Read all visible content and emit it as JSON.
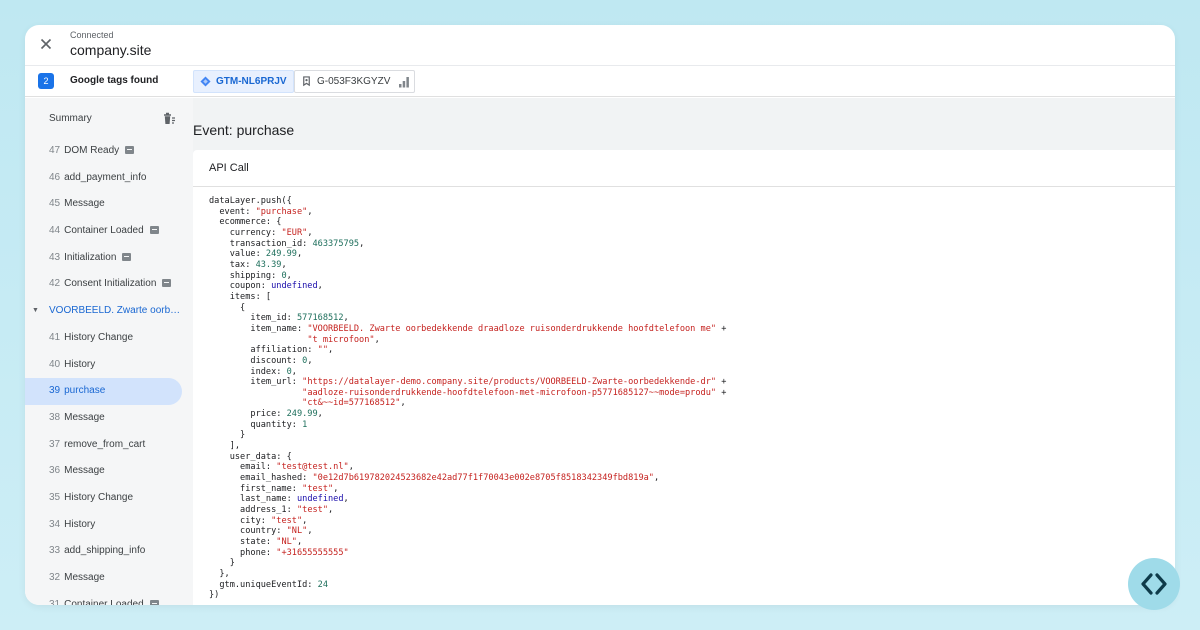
{
  "header": {
    "status": "Connected",
    "site": "company.site"
  },
  "tagsbar": {
    "count": "2",
    "label": "Google tags found",
    "tags": [
      {
        "id": "GTM-NL6PRJV",
        "icon": "gtm-diamond-icon",
        "active": true
      },
      {
        "id": "G-053F3KGYZV",
        "icon": "ga-tag-icon",
        "active": false
      }
    ]
  },
  "sidebar": {
    "summary": "Summary",
    "events": [
      {
        "num": "47",
        "label": "DOM Ready",
        "cmd": true
      },
      {
        "num": "46",
        "label": "add_payment_info",
        "cmd": false
      },
      {
        "num": "45",
        "label": "Message",
        "cmd": false
      },
      {
        "num": "44",
        "label": "Container Loaded",
        "cmd": true
      },
      {
        "num": "43",
        "label": "Initialization",
        "cmd": true
      },
      {
        "num": "42",
        "label": "Consent Initialization",
        "cmd": true
      },
      {
        "num": "",
        "label": "VOORBEELD. Zwarte oorb…",
        "cmd": false,
        "page": true
      },
      {
        "num": "41",
        "label": "History Change",
        "cmd": false
      },
      {
        "num": "40",
        "label": "History",
        "cmd": false
      },
      {
        "num": "39",
        "label": "purchase",
        "cmd": false,
        "selected": true
      },
      {
        "num": "38",
        "label": "Message",
        "cmd": false
      },
      {
        "num": "37",
        "label": "remove_from_cart",
        "cmd": false
      },
      {
        "num": "36",
        "label": "Message",
        "cmd": false
      },
      {
        "num": "35",
        "label": "History Change",
        "cmd": false
      },
      {
        "num": "34",
        "label": "History",
        "cmd": false
      },
      {
        "num": "33",
        "label": "add_shipping_info",
        "cmd": false
      },
      {
        "num": "32",
        "label": "Message",
        "cmd": false
      },
      {
        "num": "31",
        "label": "Container Loaded",
        "cmd": true
      }
    ]
  },
  "main": {
    "event_title": "Event: purchase",
    "card_title": "API Call",
    "code_lines": [
      [
        [
          "",
          "dataLayer.push({"
        ]
      ],
      [
        [
          "",
          "  event: "
        ],
        [
          "s",
          "\"purchase\""
        ],
        [
          "",
          ","
        ]
      ],
      [
        [
          "",
          "  ecommerce: {"
        ]
      ],
      [
        [
          "",
          "    currency: "
        ],
        [
          "s",
          "\"EUR\""
        ],
        [
          "",
          ","
        ]
      ],
      [
        [
          "",
          "    transaction_id: "
        ],
        [
          "n",
          "463375795"
        ],
        [
          "",
          ","
        ]
      ],
      [
        [
          "",
          "    value: "
        ],
        [
          "n",
          "249.99"
        ],
        [
          "",
          ","
        ]
      ],
      [
        [
          "",
          "    tax: "
        ],
        [
          "n",
          "43.39"
        ],
        [
          "",
          ","
        ]
      ],
      [
        [
          "",
          "    shipping: "
        ],
        [
          "n",
          "0"
        ],
        [
          "",
          ","
        ]
      ],
      [
        [
          "",
          "    coupon: "
        ],
        [
          "u",
          "undefined"
        ],
        [
          "",
          ","
        ]
      ],
      [
        [
          "",
          "    items: ["
        ]
      ],
      [
        [
          "",
          "      {"
        ]
      ],
      [
        [
          "",
          "        item_id: "
        ],
        [
          "n",
          "577168512"
        ],
        [
          "",
          ","
        ]
      ],
      [
        [
          "",
          "        item_name: "
        ],
        [
          "s",
          "\"VOORBEELD. Zwarte oorbedekkende draadloze ruisonderdrukkende hoofdtelefoon me\""
        ],
        [
          "",
          " +"
        ]
      ],
      [
        [
          "",
          "                   "
        ],
        [
          "s",
          "\"t microfoon\""
        ],
        [
          "",
          ","
        ]
      ],
      [
        [
          "",
          "        affiliation: "
        ],
        [
          "s",
          "\"\""
        ],
        [
          "",
          ","
        ]
      ],
      [
        [
          "",
          "        discount: "
        ],
        [
          "n",
          "0"
        ],
        [
          "",
          ","
        ]
      ],
      [
        [
          "",
          "        index: "
        ],
        [
          "n",
          "0"
        ],
        [
          "",
          ","
        ]
      ],
      [
        [
          "",
          "        item_url: "
        ],
        [
          "s",
          "\"https://datalayer-demo.company.site/products/VOORBEELD-Zwarte-oorbedekkende-dr\""
        ],
        [
          "",
          " +"
        ]
      ],
      [
        [
          "",
          "                  "
        ],
        [
          "s",
          "\"aadloze-ruisonderdrukkende-hoofdtelefoon-met-microfoon-p5771685127~~mode=produ\""
        ],
        [
          "",
          " +"
        ]
      ],
      [
        [
          "",
          "                  "
        ],
        [
          "s",
          "\"ct&~~id=577168512\""
        ],
        [
          "",
          ","
        ]
      ],
      [
        [
          "",
          "        price: "
        ],
        [
          "n",
          "249.99"
        ],
        [
          "",
          ","
        ]
      ],
      [
        [
          "",
          "        quantity: "
        ],
        [
          "n",
          "1"
        ]
      ],
      [
        [
          "",
          "      }"
        ]
      ],
      [
        [
          "",
          "    ],"
        ]
      ],
      [
        [
          "",
          "    user_data: {"
        ]
      ],
      [
        [
          "",
          "      email: "
        ],
        [
          "s",
          "\"test@test.nl\""
        ],
        [
          "",
          ","
        ]
      ],
      [
        [
          "",
          "      email_hashed: "
        ],
        [
          "s",
          "\"0e12d7b619782024523682e42ad77f1f70043e002e8705f8518342349fbd819a\""
        ],
        [
          "",
          ","
        ]
      ],
      [
        [
          "",
          "      first_name: "
        ],
        [
          "s",
          "\"test\""
        ],
        [
          "",
          ","
        ]
      ],
      [
        [
          "",
          "      last_name: "
        ],
        [
          "u",
          "undefined"
        ],
        [
          "",
          ","
        ]
      ],
      [
        [
          "",
          "      address_1: "
        ],
        [
          "s",
          "\"test\""
        ],
        [
          "",
          ","
        ]
      ],
      [
        [
          "",
          "      city: "
        ],
        [
          "s",
          "\"test\""
        ],
        [
          "",
          ","
        ]
      ],
      [
        [
          "",
          "      country: "
        ],
        [
          "s",
          "\"NL\""
        ],
        [
          "",
          ","
        ]
      ],
      [
        [
          "",
          "      state: "
        ],
        [
          "s",
          "\"NL\""
        ],
        [
          "",
          ","
        ]
      ],
      [
        [
          "",
          "      phone: "
        ],
        [
          "s",
          "\"+31655555555\""
        ]
      ],
      [
        [
          "",
          "    }"
        ]
      ],
      [
        [
          "",
          "  },"
        ]
      ],
      [
        [
          "",
          "  gtm.uniqueEventId: "
        ],
        [
          "n",
          "24"
        ]
      ],
      [
        [
          "",
          "})"
        ]
      ]
    ]
  },
  "colors": {
    "accent": "#1a73e8",
    "string": "#c5221f",
    "number": "#1e6f5c",
    "keyword": "#1a0dab",
    "fab": "#9fdbe9"
  }
}
